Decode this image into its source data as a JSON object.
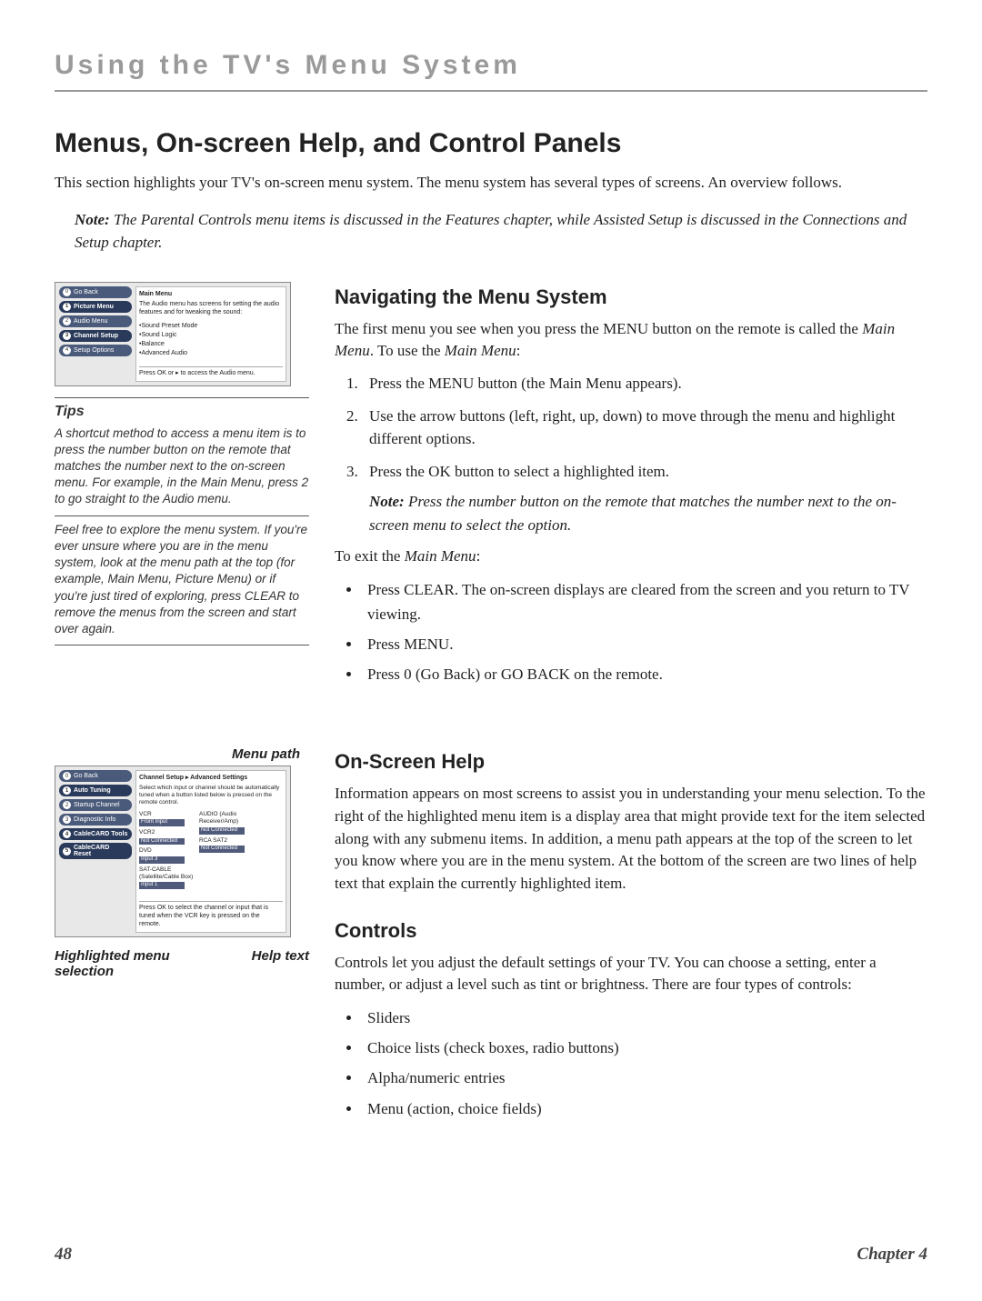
{
  "chapter_header": "Using the TV's Menu System",
  "main_title": "Menus, On-screen Help, and Control Panels",
  "intro": "This section highlights your TV's on-screen menu system. The menu system has several types of screens. An overview follows.",
  "top_note_label": "Note:",
  "top_note_text": "The Parental Controls menu items is discussed in the Features chapter, while Assisted Setup is discussed in the Connections and Setup chapter.",
  "tv1": {
    "title": "Main Menu",
    "desc": "The Audio menu has screens for setting the audio features and for tweaking the sound:",
    "nav": [
      {
        "n": "0",
        "label": "Go Back"
      },
      {
        "n": "1",
        "label": "Picture Menu"
      },
      {
        "n": "2",
        "label": "Audio Menu"
      },
      {
        "n": "3",
        "label": "Channel Setup"
      },
      {
        "n": "4",
        "label": "Setup Options"
      }
    ],
    "items": [
      "•Sound Preset Mode",
      "•Sound Logic",
      "•Balance",
      "•Advanced Audio"
    ],
    "footer": "Press OK or ▸ to access the Audio menu."
  },
  "tips_title": "Tips",
  "tip1": "A shortcut method to access a menu item is to press the number button on the remote that matches the number next to the on-screen menu. For example, in the Main Menu, press 2 to go straight to the Audio menu.",
  "tip2": "Feel free to explore the menu system. If you're ever unsure where you are in the menu system, look at the menu path at the top (for example, Main Menu, Picture Menu) or if you're just tired of exploring, press CLEAR to remove the menus from the screen and start over again.",
  "nav_head": "Navigating the Menu System",
  "nav_intro_a": "The first menu you see when you press the MENU button on the remote is called the ",
  "nav_intro_b": "Main Menu",
  "nav_intro_c": ". To use the ",
  "nav_intro_d": "Main Menu",
  "nav_intro_e": ":",
  "step1_a": "Press the MENU button (the ",
  "step1_b": "Main Menu",
  "step1_c": " appears).",
  "step2": "Use the arrow buttons (left, right, up, down) to move through the menu and highlight different options.",
  "step3": "Press the OK button to select a highlighted item.",
  "step3_note_label": "Note:",
  "step3_note": "Press the number button on the remote that matches the number next to the on-screen menu to select the option.",
  "exit_intro_a": "To exit the ",
  "exit_intro_b": "Main Menu",
  "exit_intro_c": ":",
  "exit1": "Press CLEAR. The on-screen displays are cleared from the screen and you return to TV viewing.",
  "exit2": "Press MENU.",
  "exit3": "Press 0 (Go Back) or GO BACK on the remote.",
  "annot_menupath": "Menu path",
  "annot_highlighted": "Highlighted menu selection",
  "annot_helptext": "Help text",
  "tv2": {
    "title": "Channel Setup ▸ Advanced Settings",
    "desc": "Select which input or channel should be automatically tuned when a button listed below is pressed on the remote control.",
    "nav": [
      {
        "n": "0",
        "label": "Go Back"
      },
      {
        "n": "1",
        "label": "Auto Tuning"
      },
      {
        "n": "2",
        "label": "Startup Channel"
      },
      {
        "n": "3",
        "label": "Diagnostic Info"
      },
      {
        "n": "4",
        "label": "CableCARD Tools"
      },
      {
        "n": "5",
        "label": "CableCARD Reset"
      }
    ],
    "col1": [
      "VCR",
      "Front Input",
      "VCR2",
      "Not Connected",
      "DVD",
      "Input 3",
      "SAT-CABLE (Satellite/Cable Box)",
      "Input 1"
    ],
    "col2": [
      "AUDIO (Audio Receiver/Amp)",
      "Not Connected",
      "RCA SAT2",
      "Not Connected"
    ],
    "footer": "Press OK to select the channel or input that is tuned when the VCR key is pressed on the remote."
  },
  "onscreen_head": "On-Screen Help",
  "onscreen_body": "Information appears on most screens to assist you in understanding your menu selection. To the right of the highlighted menu item is a display area that might provide text for the item selected along with any submenu items. In addition, a menu path appears at the top of the screen to let you know where you are in the menu system. At the bottom of the screen are two lines of help text that explain the currently highlighted item.",
  "controls_head": "Controls",
  "controls_body": "Controls let you adjust the default settings of your TV. You can choose a setting, enter a number, or adjust a level such as tint or brightness. There are four types of controls:",
  "ctrl1": "Sliders",
  "ctrl2": "Choice lists (check boxes, radio buttons)",
  "ctrl3": "Alpha/numeric entries",
  "ctrl4": "Menu (action, choice fields)",
  "page_num": "48",
  "chapter_label": "Chapter 4"
}
